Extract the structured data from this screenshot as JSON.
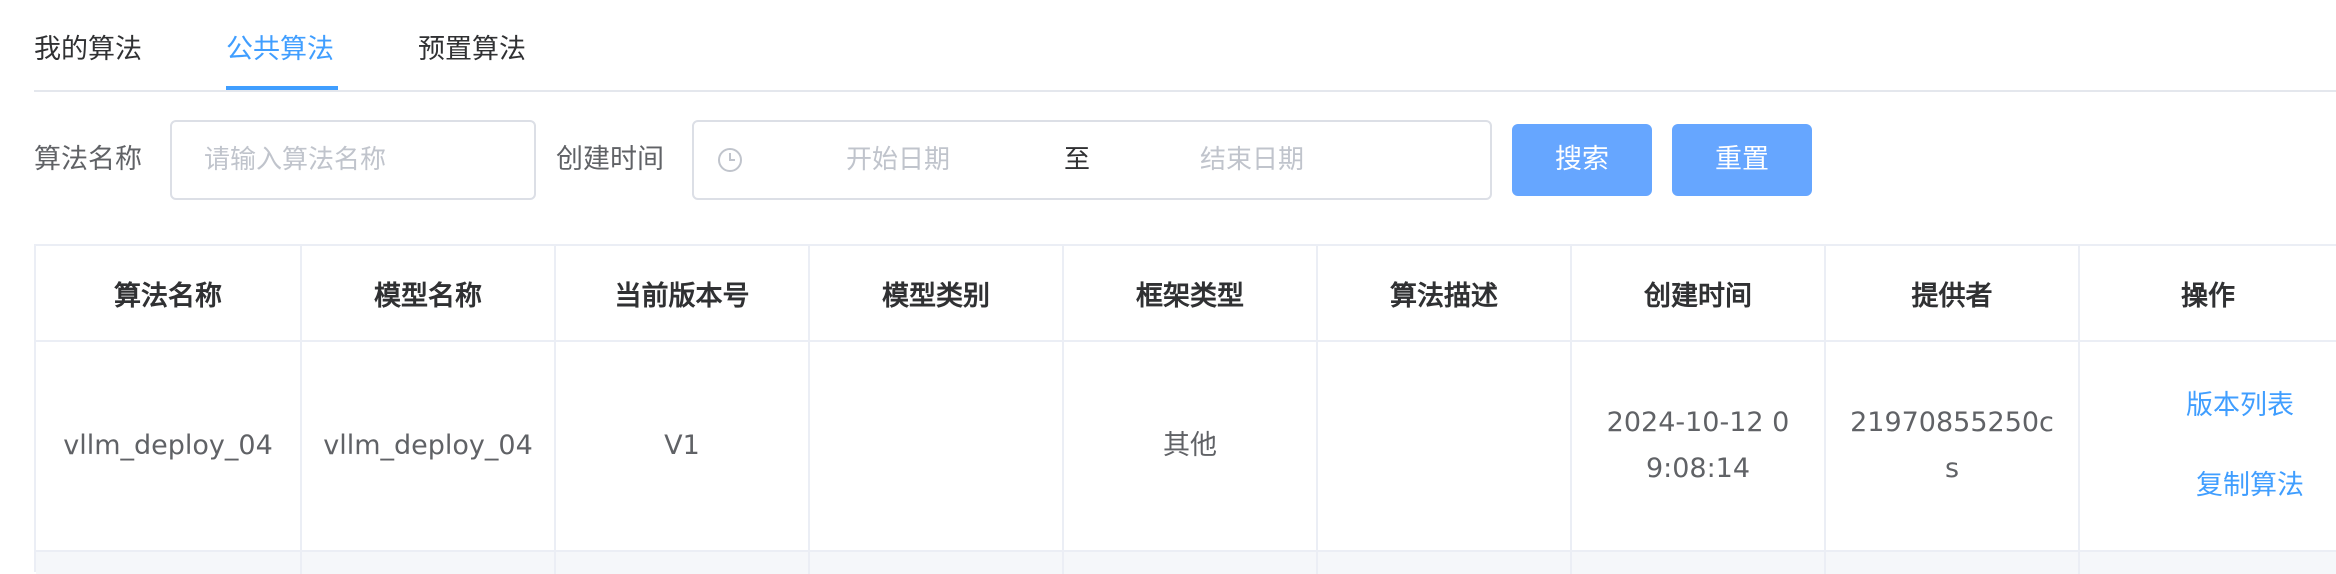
{
  "tabs": [
    {
      "label": "我的算法",
      "active": false
    },
    {
      "label": "公共算法",
      "active": true
    },
    {
      "label": "预置算法",
      "active": false
    }
  ],
  "filters": {
    "name_label": "算法名称",
    "name_placeholder": "请输入算法名称",
    "time_label": "创建时间",
    "start_placeholder": "开始日期",
    "range_separator": "至",
    "end_placeholder": "结束日期",
    "clock_icon": "clock-icon"
  },
  "buttons": {
    "search": "搜索",
    "reset": "重置"
  },
  "colors": {
    "accent": "#409eff",
    "button_bg": "#66a6ff",
    "border": "#ebeef5"
  },
  "table": {
    "columns": [
      "算法名称",
      "模型名称",
      "当前版本号",
      "模型类别",
      "框架类型",
      "算法描述",
      "创建时间",
      "提供者",
      "操作"
    ],
    "rows": [
      {
        "algorithm_name": "vllm_deploy_04",
        "model_name": "vllm_deploy_04",
        "version": "V1",
        "model_category": "",
        "framework_type": "其他",
        "description": "",
        "created_at": "2024-10-12 09:08:14",
        "provider": "21970855250cs",
        "actions": [
          "版本列表",
          "复制算法"
        ]
      }
    ]
  }
}
